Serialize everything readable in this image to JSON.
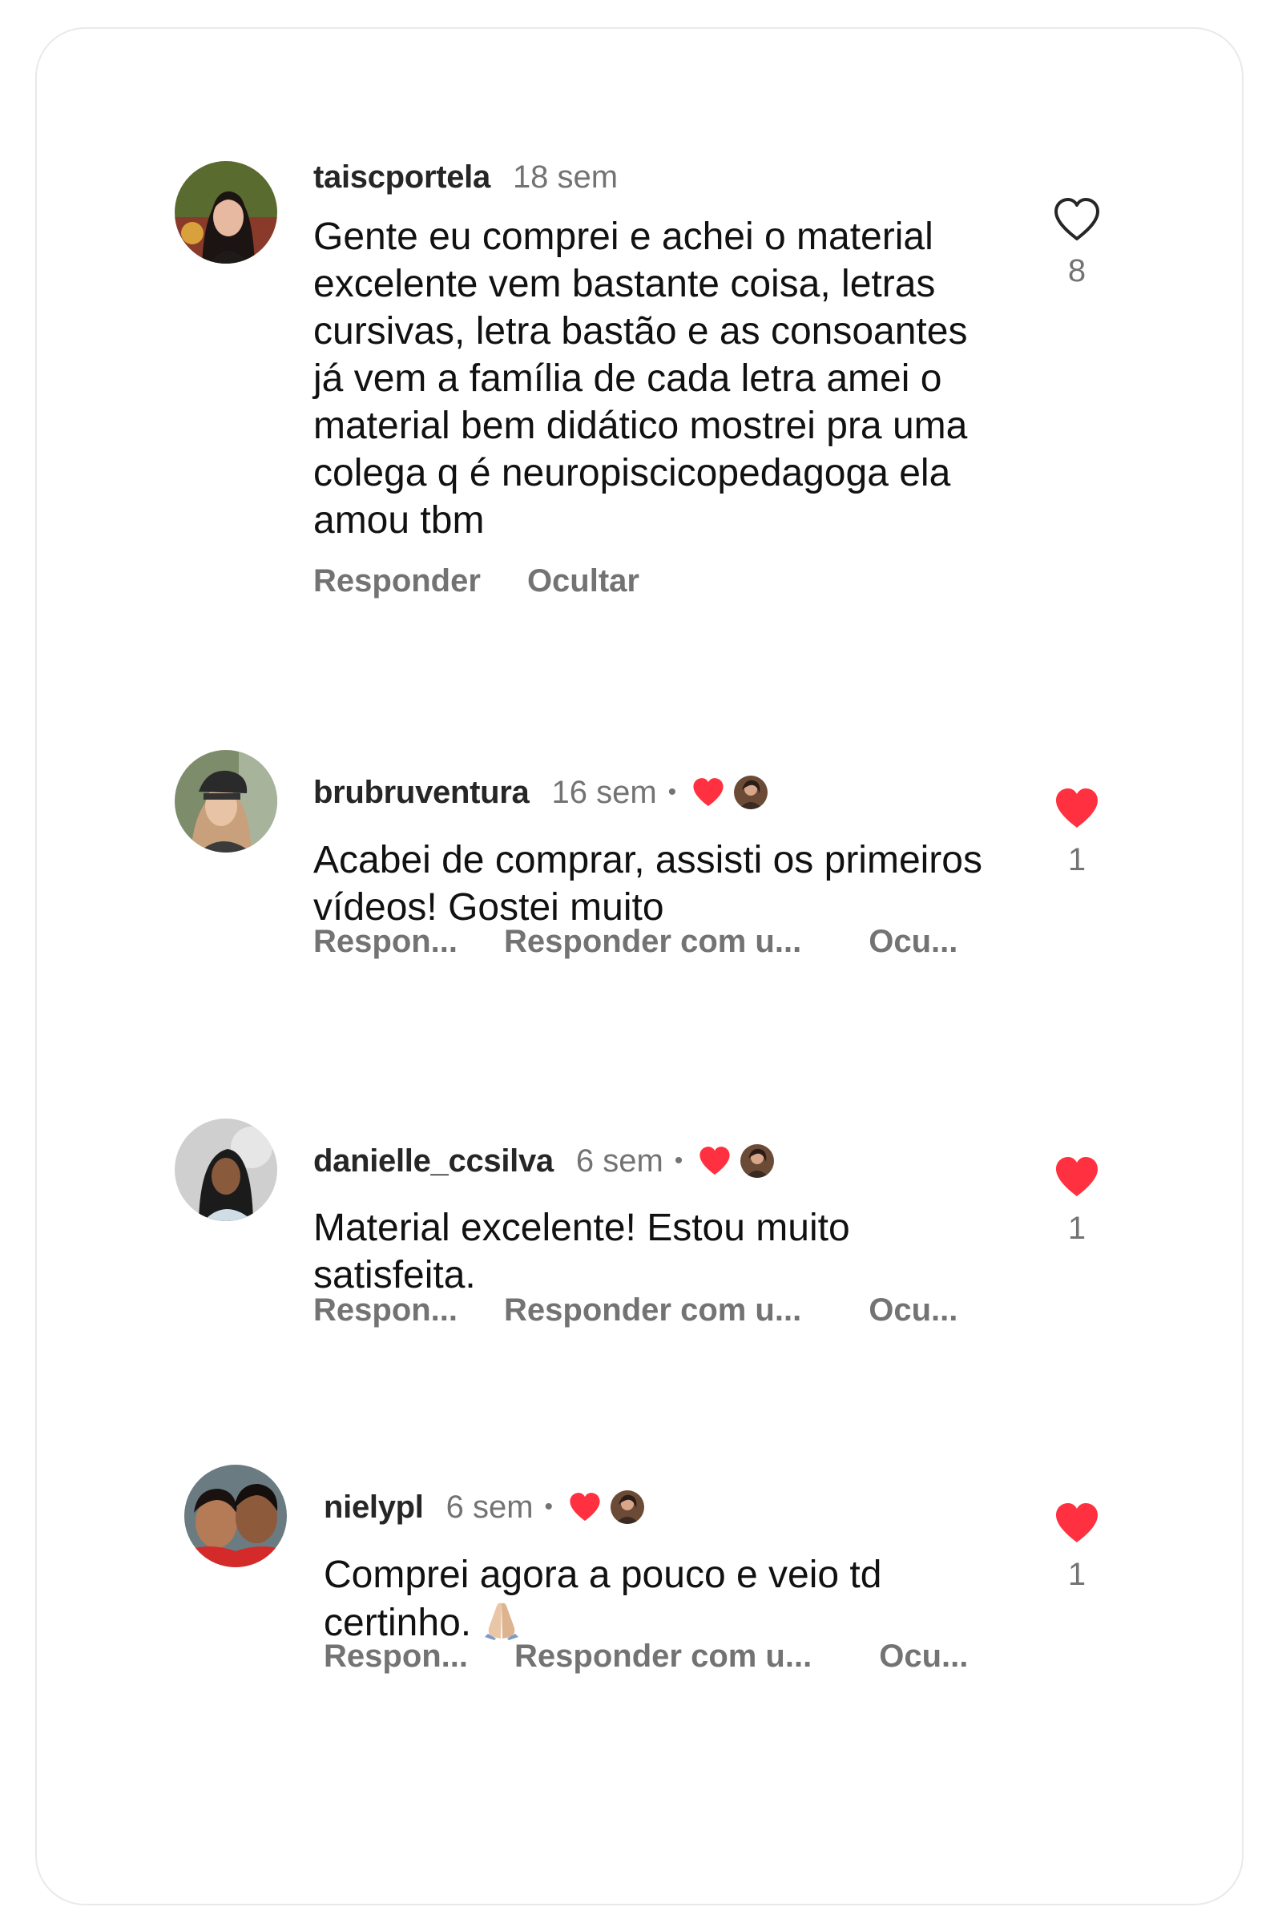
{
  "comments": [
    {
      "username": "taiscportela",
      "time": "18 sem",
      "text": "Gente eu comprei e achei o material excelente vem bastante coisa, letras cursivas, letra bastão e as consoantes já vem a família de cada letra amei o material bem didático mostrei pra uma colega q é neuropiscicopedagoga ela amou tbm",
      "actions": [
        "Responder",
        "Ocultar"
      ],
      "likes": "8",
      "liked": false,
      "creator_liked": false
    },
    {
      "username": "brubruventura",
      "time": "16 sem",
      "separator": "•",
      "text": "Acabei de comprar, assisti os primeiros vídeos! Gostei muito",
      "actions": [
        "Respon...",
        "Responder com u...",
        "Ocu..."
      ],
      "likes": "1",
      "liked": true,
      "creator_liked": true
    },
    {
      "username": "danielle_ccsilva",
      "time": "6 sem",
      "separator": "•",
      "text": "Material excelente! Estou muito satisfeita.",
      "actions": [
        "Respon...",
        "Responder com u...",
        "Ocu..."
      ],
      "likes": "1",
      "liked": true,
      "creator_liked": true
    },
    {
      "username": "nielypl",
      "time": "6 sem",
      "separator": "•",
      "text": "Comprei agora a pouco e veio td certinho.",
      "emoji": "folded-hands-icon",
      "actions": [
        "Respon...",
        "Responder com u...",
        "Ocu..."
      ],
      "likes": "1",
      "liked": true,
      "creator_liked": true
    }
  ],
  "colors": {
    "username": "#262626",
    "secondary_text": "#737373",
    "body_text": "#111111",
    "heart_red": "#ff3040",
    "card_border": "#e9e9e9"
  }
}
